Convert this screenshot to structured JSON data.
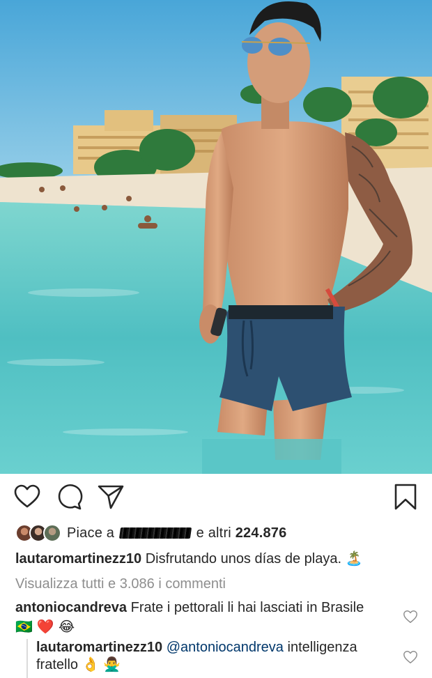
{
  "post": {
    "image_subject": "beach-photo"
  },
  "actions": {
    "like_icon": "heart-icon",
    "comment_icon": "comment-icon",
    "share_icon": "paper-plane-icon",
    "save_icon": "bookmark-icon"
  },
  "likes": {
    "prefix": "Piace a",
    "suffix": "e altri",
    "count": "224.876"
  },
  "caption": {
    "username": "lautaromartinezz10",
    "text": "Disfrutando unos días de playa.",
    "emoji": "🏝️"
  },
  "view_all_comments": "Visualizza tutti e 3.086 i commenti",
  "comments": [
    {
      "username": "antoniocandreva",
      "text": "Frate i pettorali li hai lasciati in Brasile",
      "emojis": [
        "🇧🇷",
        "❤️",
        "😂"
      ]
    },
    {
      "username": "lautaromartinezz10",
      "mention": "@antoniocandreva",
      "text": "intelligenza fratello",
      "emojis": [
        "👌",
        "🙅‍♂️"
      ]
    }
  ],
  "colors": {
    "text": "#262626",
    "secondary": "#8e8e8e",
    "mention": "#00376b",
    "sea": "#5cc8c9",
    "sky": "#5bb4dd"
  }
}
